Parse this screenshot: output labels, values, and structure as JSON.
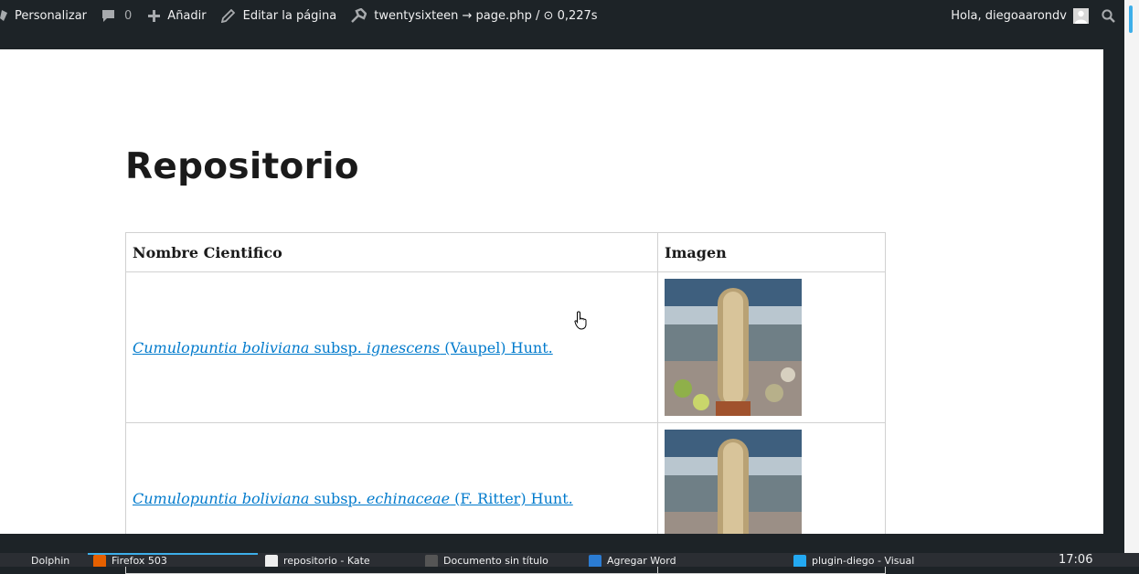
{
  "adminbar": {
    "customize_label": "Personalizar",
    "comments_count": "0",
    "add_label": "Añadir",
    "edit_label": "Editar la página",
    "query_monitor": "twentysixteen → page.php / ⊙ 0,227s",
    "greeting": "Hola, diegoaarondv"
  },
  "page": {
    "title": "Repositorio",
    "table": {
      "headers": [
        "Nombre Cientifico",
        "Imagen"
      ],
      "rows": [
        {
          "genus_species": "Cumulopuntia boliviana",
          "rank": " subsp. ",
          "infra": "ignescens",
          "author": " (Vaupel) Hunt."
        },
        {
          "genus_species": "Cumulopuntia boliviana",
          "rank": " subsp. ",
          "infra": "echinaceae",
          "author": " (F. Ritter) Hunt."
        }
      ]
    }
  },
  "taskbar": {
    "tasks": [
      {
        "label": "Dolphin"
      },
      {
        "label": "Firefox 503"
      },
      {
        "label": "repositorio - Kate"
      },
      {
        "label": "Documento sin título"
      },
      {
        "label": "Agregar Word"
      },
      {
        "label": "plugin-diego - Visual"
      }
    ],
    "clock": "17:06"
  },
  "colors": {
    "adminbar_bg": "#1d2327",
    "link": "#007acc",
    "accent": "#3daee9"
  }
}
